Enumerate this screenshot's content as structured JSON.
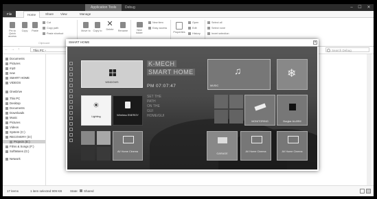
{
  "explorer": {
    "title_context": "Application Tools",
    "title": "Debug",
    "window_controls": [
      "–",
      "☐",
      "✕"
    ]
  },
  "ribbon": {
    "tabs": [
      "File",
      "Home",
      "Share",
      "View",
      "Manage"
    ],
    "active_tab": "Home",
    "big_buttons": [
      "Pin to Quick access",
      "Copy",
      "Paste",
      "Move to",
      "Copy to",
      "Delete",
      "Rename",
      "New folder",
      "Properties"
    ],
    "small_buttons": [
      "Cut",
      "Copy path",
      "Paste shortcut",
      "New item",
      "Easy access",
      "Open",
      "Edit",
      "History",
      "Select all",
      "Select none",
      "Invert selection"
    ],
    "groups": [
      "Clipboard",
      "Organize",
      "New",
      "Open",
      "Select"
    ]
  },
  "address": {
    "path": "This PC  ›",
    "search_placeholder": "Search Debug"
  },
  "nav_pane": {
    "items": [
      {
        "label": "Documents",
        "selected": false
      },
      {
        "label": "Pictures",
        "selected": false
      },
      {
        "label": "mp3",
        "selected": false
      },
      {
        "label": "new",
        "selected": false
      },
      {
        "label": "SMART HOME",
        "selected": false
      },
      {
        "label": "VIDEOS",
        "selected": false
      },
      {
        "label": "OneDrive",
        "selected": false
      },
      {
        "label": "This PC",
        "selected": false
      },
      {
        "label": "Desktop",
        "selected": false
      },
      {
        "label": "Documents",
        "selected": false
      },
      {
        "label": "Downloads",
        "selected": false
      },
      {
        "label": "Music",
        "selected": false
      },
      {
        "label": "Pictures",
        "selected": false
      },
      {
        "label": "Videos",
        "selected": false
      },
      {
        "label": "System (C:)",
        "selected": false
      },
      {
        "label": "RECOVERY (D:)",
        "selected": false
      },
      {
        "label": "Projects (E:)",
        "selected": true
      },
      {
        "label": "Films & Songs (F:)",
        "selected": false
      },
      {
        "label": "SoftWares (G:)",
        "selected": false
      },
      {
        "label": "Network",
        "selected": false
      }
    ]
  },
  "status": {
    "items_count": "17 items",
    "selection": "1 item selected  909 KB",
    "state": "State:",
    "shared": "Shared"
  },
  "app": {
    "window_title": "SMART HOME",
    "brand_line1": "K-MECH",
    "brand_line2": "SMART HOME",
    "clock": "PM 07:07:47",
    "ghost_text": [
      "SET THE",
      "PATH",
      "ON THE",
      "GUI",
      "HOME/GUI"
    ],
    "tiles": {
      "windows": "WINDOWS",
      "music": "MUSIC",
      "ac": "",
      "lighting": "Lighting",
      "smart_wifi": "Wireless ENERGY",
      "monitoring": "MONITORING",
      "burglar": "Burglar ALARM",
      "av_home_1": "AV Home Cinema",
      "garage": "GARAGE",
      "av_home_2": "AV Home Cinema",
      "av_home_3": "AV Home Cinema"
    }
  }
}
